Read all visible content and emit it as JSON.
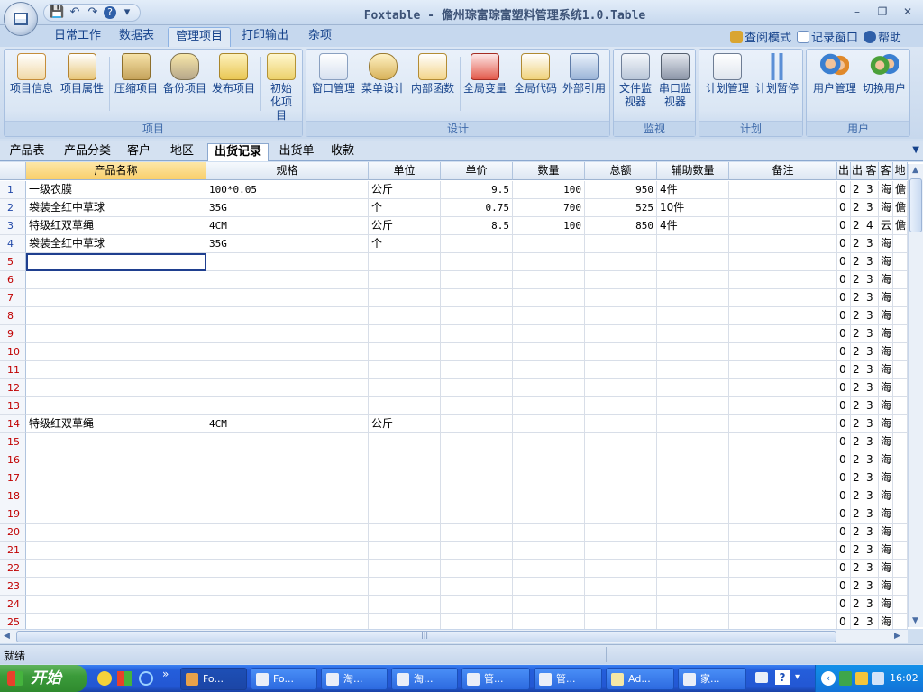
{
  "window": {
    "title": "Foxtable - 儋州琮富琮富塑料管理系统1.0.Table",
    "min": "–",
    "max": "❐",
    "close": "✕"
  },
  "qat": {
    "save": "💾",
    "undo": "↶",
    "redo": "↷",
    "help": "?",
    "more": "▾"
  },
  "ribbon_tabs": [
    "日常工作",
    "数据表",
    "管理项目",
    "打印输出",
    "杂项"
  ],
  "ribbon_right": {
    "view_mode": "查阅模式",
    "record_window": "记录窗口",
    "help": "帮助"
  },
  "groups": {
    "project": {
      "label": "项目",
      "buttons": [
        "项目信息",
        "项目属性",
        "压缩项目",
        "备份项目",
        "发布项目",
        "初始化项目"
      ]
    },
    "design": {
      "label": "设计",
      "buttons": [
        "窗口管理",
        "菜单设计",
        "内部函数",
        "全局变量",
        "全局代码",
        "外部引用"
      ]
    },
    "monitor": {
      "label": "监视",
      "buttons": [
        "文件监视器",
        "串口监视器"
      ]
    },
    "plan": {
      "label": "计划",
      "buttons": [
        "计划管理",
        "计划暂停"
      ]
    },
    "user": {
      "label": "用户",
      "buttons": [
        "用户管理",
        "切换用户"
      ]
    }
  },
  "sheet_tabs": [
    "产品表",
    "产品分类",
    "客户",
    "地区",
    "出货记录",
    "出货单",
    "收款"
  ],
  "sheet_menu_icon": "▼",
  "columns": [
    "产品名称",
    "规格",
    "单位",
    "单价",
    "数量",
    "总额",
    "辅助数量",
    "备注",
    "出",
    "出",
    "客",
    "客",
    "地"
  ],
  "rows": [
    {
      "n": "1",
      "name": "一级农膜",
      "spec": "100*0.05",
      "unit": "公斤",
      "price": "9.5",
      "qty": "100",
      "total": "950",
      "aux": "4件",
      "note": "",
      "c1": "0",
      "c2": "2",
      "c3": "3",
      "c4": "海",
      "c5": "儋"
    },
    {
      "n": "2",
      "name": "袋装全红中草球",
      "spec": "35G",
      "unit": "个",
      "price": "0.75",
      "qty": "700",
      "total": "525",
      "aux": "10件",
      "note": "",
      "c1": "0",
      "c2": "2",
      "c3": "3",
      "c4": "海",
      "c5": "儋"
    },
    {
      "n": "3",
      "name": "特级红双草绳",
      "spec": "4CM",
      "unit": "公斤",
      "price": "8.5",
      "qty": "100",
      "total": "850",
      "aux": "4件",
      "note": "",
      "c1": "0",
      "c2": "2",
      "c3": "4",
      "c4": "云",
      "c5": "儋"
    },
    {
      "n": "4",
      "name": "袋装全红中草球",
      "spec": "35G",
      "unit": "个",
      "price": "",
      "qty": "",
      "total": "",
      "aux": "",
      "note": "",
      "c1": "0",
      "c2": "2",
      "c3": "3",
      "c4": "海",
      "c5": ""
    },
    {
      "n": "5",
      "name": "",
      "spec": "",
      "unit": "",
      "price": "",
      "qty": "",
      "total": "",
      "aux": "",
      "note": "",
      "c1": "0",
      "c2": "2",
      "c3": "3",
      "c4": "海",
      "c5": ""
    },
    {
      "n": "6",
      "name": "",
      "spec": "",
      "unit": "",
      "price": "",
      "qty": "",
      "total": "",
      "aux": "",
      "note": "",
      "c1": "0",
      "c2": "2",
      "c3": "3",
      "c4": "海",
      "c5": ""
    },
    {
      "n": "7",
      "name": "",
      "spec": "",
      "unit": "",
      "price": "",
      "qty": "",
      "total": "",
      "aux": "",
      "note": "",
      "c1": "0",
      "c2": "2",
      "c3": "3",
      "c4": "海",
      "c5": ""
    },
    {
      "n": "8",
      "name": "",
      "spec": "",
      "unit": "",
      "price": "",
      "qty": "",
      "total": "",
      "aux": "",
      "note": "",
      "c1": "0",
      "c2": "2",
      "c3": "3",
      "c4": "海",
      "c5": ""
    },
    {
      "n": "9",
      "name": "",
      "spec": "",
      "unit": "",
      "price": "",
      "qty": "",
      "total": "",
      "aux": "",
      "note": "",
      "c1": "0",
      "c2": "2",
      "c3": "3",
      "c4": "海",
      "c5": ""
    },
    {
      "n": "10",
      "name": "",
      "spec": "",
      "unit": "",
      "price": "",
      "qty": "",
      "total": "",
      "aux": "",
      "note": "",
      "c1": "0",
      "c2": "2",
      "c3": "3",
      "c4": "海",
      "c5": ""
    },
    {
      "n": "11",
      "name": "",
      "spec": "",
      "unit": "",
      "price": "",
      "qty": "",
      "total": "",
      "aux": "",
      "note": "",
      "c1": "0",
      "c2": "2",
      "c3": "3",
      "c4": "海",
      "c5": ""
    },
    {
      "n": "12",
      "name": "",
      "spec": "",
      "unit": "",
      "price": "",
      "qty": "",
      "total": "",
      "aux": "",
      "note": "",
      "c1": "0",
      "c2": "2",
      "c3": "3",
      "c4": "海",
      "c5": ""
    },
    {
      "n": "13",
      "name": "",
      "spec": "",
      "unit": "",
      "price": "",
      "qty": "",
      "total": "",
      "aux": "",
      "note": "",
      "c1": "0",
      "c2": "2",
      "c3": "3",
      "c4": "海",
      "c5": ""
    },
    {
      "n": "14",
      "name": "特级红双草绳",
      "spec": "4CM",
      "unit": "公斤",
      "price": "",
      "qty": "",
      "total": "",
      "aux": "",
      "note": "",
      "c1": "0",
      "c2": "2",
      "c3": "3",
      "c4": "海",
      "c5": ""
    },
    {
      "n": "15",
      "name": "",
      "spec": "",
      "unit": "",
      "price": "",
      "qty": "",
      "total": "",
      "aux": "",
      "note": "",
      "c1": "0",
      "c2": "2",
      "c3": "3",
      "c4": "海",
      "c5": ""
    },
    {
      "n": "16",
      "name": "",
      "spec": "",
      "unit": "",
      "price": "",
      "qty": "",
      "total": "",
      "aux": "",
      "note": "",
      "c1": "0",
      "c2": "2",
      "c3": "3",
      "c4": "海",
      "c5": ""
    },
    {
      "n": "17",
      "name": "",
      "spec": "",
      "unit": "",
      "price": "",
      "qty": "",
      "total": "",
      "aux": "",
      "note": "",
      "c1": "0",
      "c2": "2",
      "c3": "3",
      "c4": "海",
      "c5": ""
    },
    {
      "n": "18",
      "name": "",
      "spec": "",
      "unit": "",
      "price": "",
      "qty": "",
      "total": "",
      "aux": "",
      "note": "",
      "c1": "0",
      "c2": "2",
      "c3": "3",
      "c4": "海",
      "c5": ""
    },
    {
      "n": "19",
      "name": "",
      "spec": "",
      "unit": "",
      "price": "",
      "qty": "",
      "total": "",
      "aux": "",
      "note": "",
      "c1": "0",
      "c2": "2",
      "c3": "3",
      "c4": "海",
      "c5": ""
    },
    {
      "n": "20",
      "name": "",
      "spec": "",
      "unit": "",
      "price": "",
      "qty": "",
      "total": "",
      "aux": "",
      "note": "",
      "c1": "0",
      "c2": "2",
      "c3": "3",
      "c4": "海",
      "c5": ""
    },
    {
      "n": "21",
      "name": "",
      "spec": "",
      "unit": "",
      "price": "",
      "qty": "",
      "total": "",
      "aux": "",
      "note": "",
      "c1": "0",
      "c2": "2",
      "c3": "3",
      "c4": "海",
      "c5": ""
    },
    {
      "n": "22",
      "name": "",
      "spec": "",
      "unit": "",
      "price": "",
      "qty": "",
      "total": "",
      "aux": "",
      "note": "",
      "c1": "0",
      "c2": "2",
      "c3": "3",
      "c4": "海",
      "c5": ""
    },
    {
      "n": "23",
      "name": "",
      "spec": "",
      "unit": "",
      "price": "",
      "qty": "",
      "total": "",
      "aux": "",
      "note": "",
      "c1": "0",
      "c2": "2",
      "c3": "3",
      "c4": "海",
      "c5": ""
    },
    {
      "n": "24",
      "name": "",
      "spec": "",
      "unit": "",
      "price": "",
      "qty": "",
      "total": "",
      "aux": "",
      "note": "",
      "c1": "0",
      "c2": "2",
      "c3": "3",
      "c4": "海",
      "c5": ""
    },
    {
      "n": "25",
      "name": "",
      "spec": "",
      "unit": "",
      "price": "",
      "qty": "",
      "total": "",
      "aux": "",
      "note": "",
      "c1": "0",
      "c2": "2",
      "c3": "3",
      "c4": "海",
      "c5": ""
    }
  ],
  "status": {
    "text": "就绪"
  },
  "taskbar": {
    "start": "开始",
    "items": [
      "Fo...",
      "Fo...",
      "淘...",
      "淘...",
      "管...",
      "管...",
      "Ad...",
      "家..."
    ],
    "clock": "16:02",
    "chevron": "»"
  },
  "scroll": {
    "up": "▲",
    "down": "▼",
    "left": "◀",
    "right": "▶",
    "grip": "|||"
  }
}
